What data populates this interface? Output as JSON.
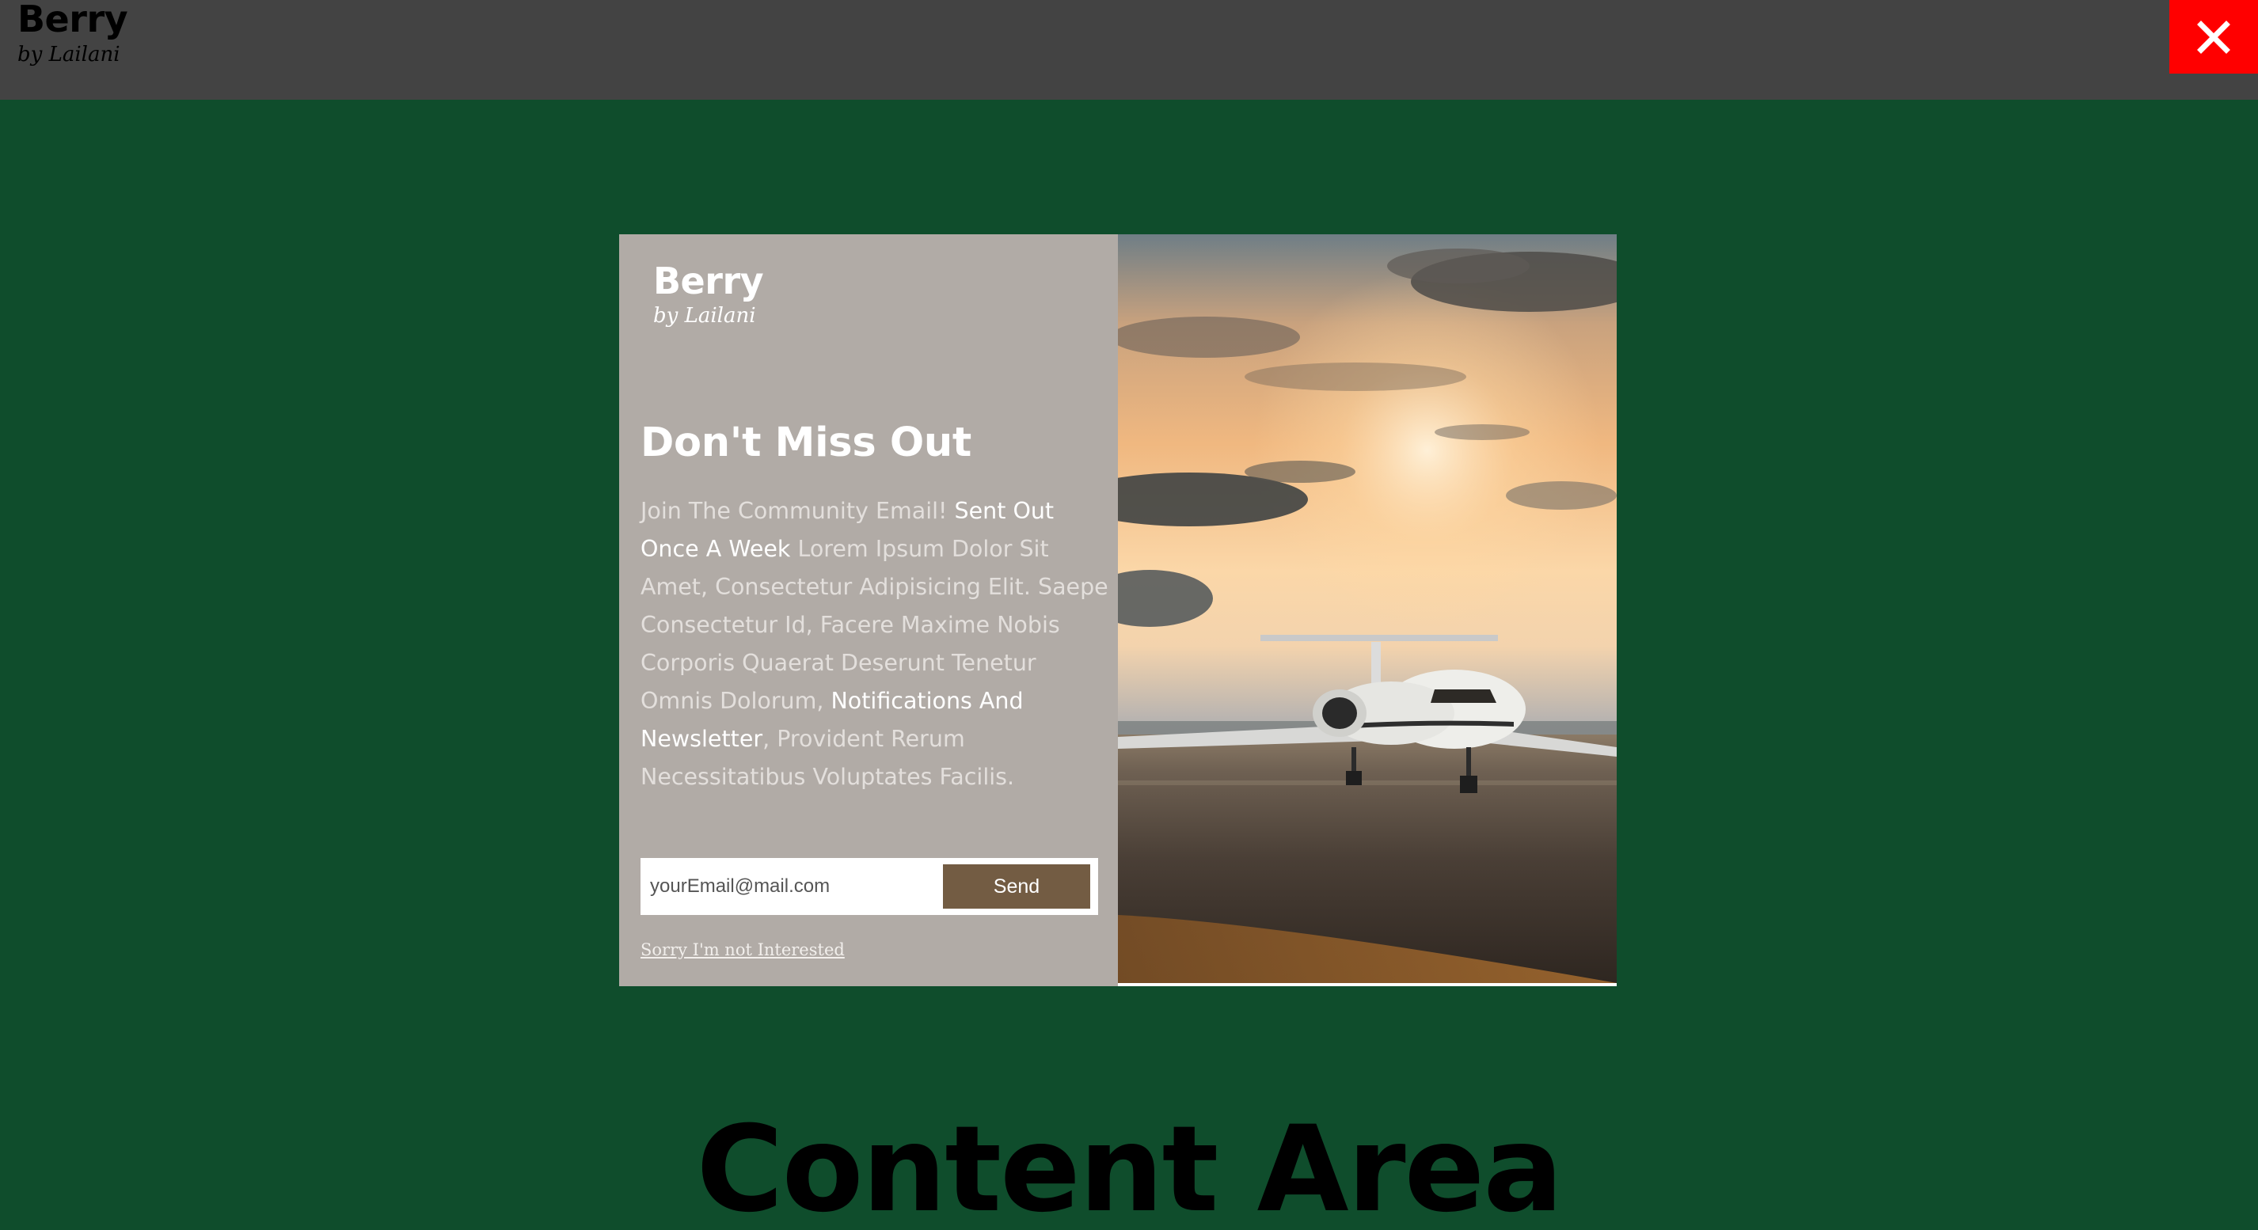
{
  "header": {
    "brand_name": "Berry",
    "brand_tagline": "by Lailani",
    "close_icon": "close-icon",
    "close_bg": "#ff0000"
  },
  "modal": {
    "brand_name": "Berry",
    "brand_tagline": "by Lailani",
    "title": "Don't Miss Out",
    "text_part1": "Join The Community Email! ",
    "text_highlight1": "Sent Out Once A Week",
    "text_part2": " Lorem Ipsum Dolor Sit Amet, Consectetur Adipisicing Elit. Saepe Consectetur Id, Facere Maxime Nobis Corporis Quaerat Deserunt Tenetur Omnis Dolorum, ",
    "text_highlight2": "Notifications And Newsletter",
    "text_part3": ", Provident Rerum Necessitatibus Voluptates Facilis.",
    "email_placeholder": "yourEmail@mail.com",
    "send_label": "Send",
    "decline_label": "Sorry I'm not Interested",
    "image": "private-jet-on-runway-at-sunset-photo"
  },
  "main": {
    "heading": "Content Area"
  },
  "colors": {
    "page_bg": "#0f4d2c",
    "header_bg": "#434343",
    "modal_left_bg": "#b1aba6",
    "send_button_bg": "#735c43"
  }
}
